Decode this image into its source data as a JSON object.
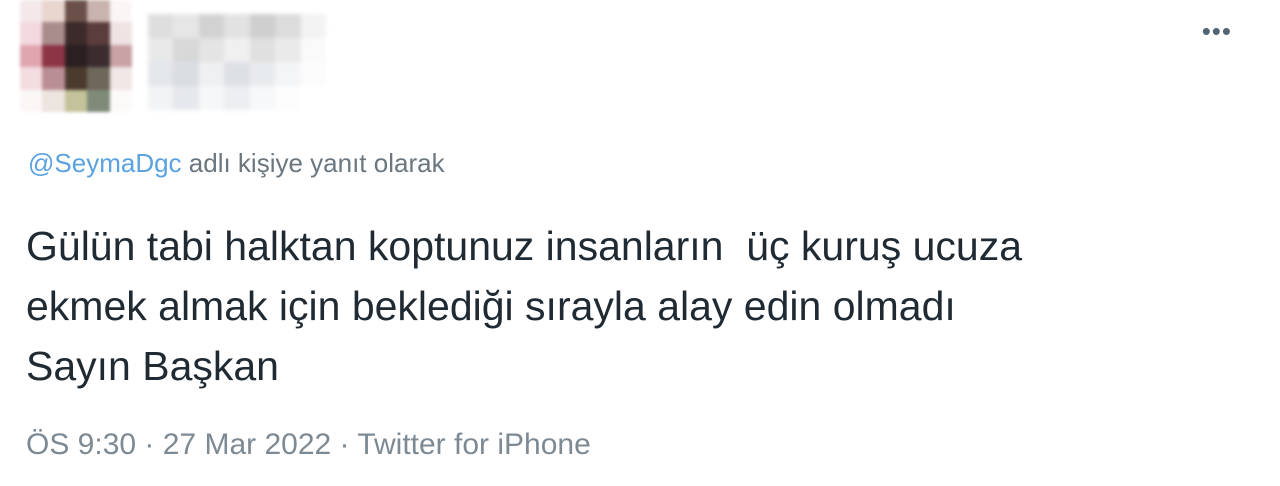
{
  "tweet": {
    "more_icon": "more-horizontal-icon",
    "more_glyph": "•••",
    "reply_mention": "@SeymaDgc",
    "reply_suffix": " adlı kişiye yanıt olarak",
    "text": "Gülün tabi halktan koptunuz insanların  üç kuruş ucuza\nekmek almak için beklediği sırayla alay edin olmadı\nSayın Başkan",
    "time": "ÖS 9:30",
    "sep1": " · ",
    "date": "27 Mar 2022",
    "sep2": " · ",
    "source": "Twitter for iPhone"
  },
  "colors": {
    "mention": "#5aa2e0",
    "text": "#1f2a33",
    "meta": "#7d8a93"
  }
}
